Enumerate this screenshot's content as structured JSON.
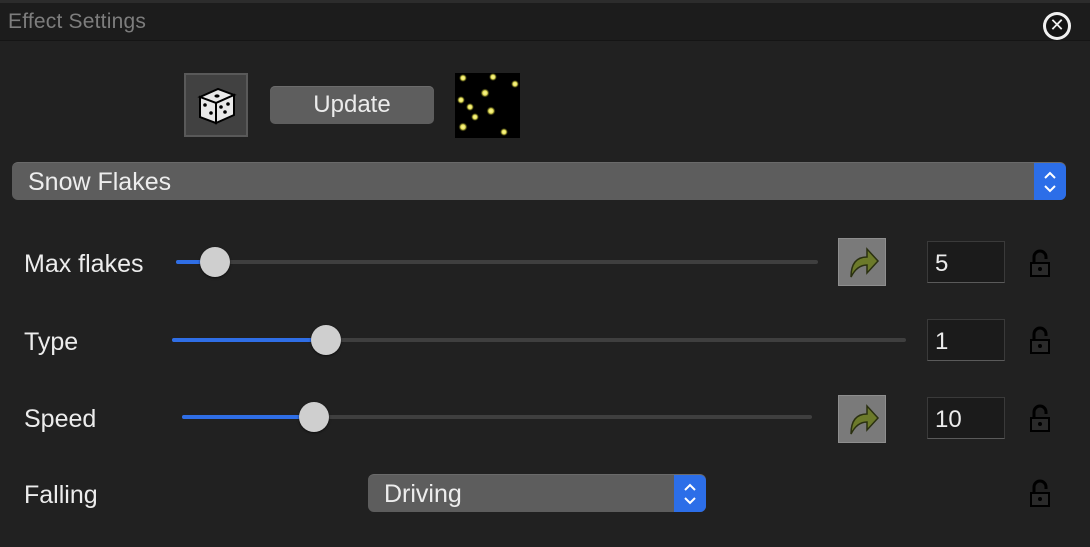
{
  "window": {
    "title": "Effect Settings"
  },
  "toolbar": {
    "update_label": "Update"
  },
  "effect": {
    "selected": "Snow Flakes"
  },
  "params": [
    {
      "label": "Max flakes",
      "value": "5",
      "level": 0.06,
      "has_reset": true
    },
    {
      "label": "Type",
      "value": "1",
      "level": 0.21,
      "has_reset": false
    },
    {
      "label": "Speed",
      "value": "10",
      "level": 0.21,
      "has_reset": true
    }
  ],
  "falling": {
    "label": "Falling",
    "selected": "Driving"
  },
  "colors": {
    "accent": "#2f6ee6",
    "background": "#212121",
    "snowflake": "#e8e35a"
  },
  "icons": {
    "close": "close-circle-icon",
    "dice": "dice-icon",
    "reset": "redo-arrow-icon",
    "lock": "unlocked-padlock-icon",
    "stepper": "up-down-chevron-icon"
  }
}
